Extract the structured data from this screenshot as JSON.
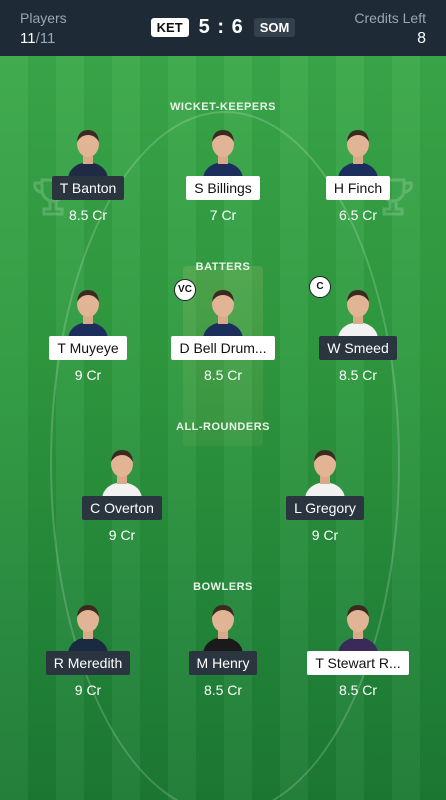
{
  "header": {
    "players_label": "Players",
    "players_selected": "11",
    "players_total": "/11",
    "team_home": "KET",
    "score": "5 : 6",
    "team_away": "SOM",
    "credits_label": "Credits Left",
    "credits_value": "8"
  },
  "sections": {
    "wk": "WICKET-KEEPERS",
    "bat": "BATTERS",
    "ar": "ALL-ROUNDERS",
    "bowl": "BOWLERS"
  },
  "players": {
    "wk1": {
      "name": "T Banton",
      "credits": "8.5 Cr",
      "shirt": "#1f2a44"
    },
    "wk2": {
      "name": "S Billings",
      "credits": "7 Cr",
      "shirt": "#1c2f5c"
    },
    "wk3": {
      "name": "H Finch",
      "credits": "6.5 Cr",
      "shirt": "#1c2f5c"
    },
    "bat1": {
      "name": "T Muyeye",
      "credits": "9 Cr",
      "shirt": "#1c2f5c"
    },
    "bat2": {
      "name": "D Bell Drum...",
      "credits": "8.5 Cr",
      "shirt": "#1c2f5c",
      "badge": "VC"
    },
    "bat3": {
      "name": "W Smeed",
      "credits": "8.5 Cr",
      "shirt": "#f2f2f2",
      "badge": "C"
    },
    "ar1": {
      "name": "C Overton",
      "credits": "9 Cr",
      "shirt": "#f2f2f2"
    },
    "ar2": {
      "name": "L Gregory",
      "credits": "9 Cr",
      "shirt": "#f2f2f2"
    },
    "bowl1": {
      "name": "R Meredith",
      "credits": "9 Cr",
      "shirt": "#1a2a40"
    },
    "bowl2": {
      "name": "M Henry",
      "credits": "8.5 Cr",
      "shirt": "#1a1a1a"
    },
    "bowl3": {
      "name": "T Stewart R...",
      "credits": "8.5 Cr",
      "shirt": "#3a2a5a"
    }
  },
  "colors": {
    "field_top": "#3aa84a",
    "field_bottom": "#1c7a33",
    "header_bg": "#1e2a35",
    "tag_dark": "#2a3540",
    "tag_light": "#ffffff"
  }
}
